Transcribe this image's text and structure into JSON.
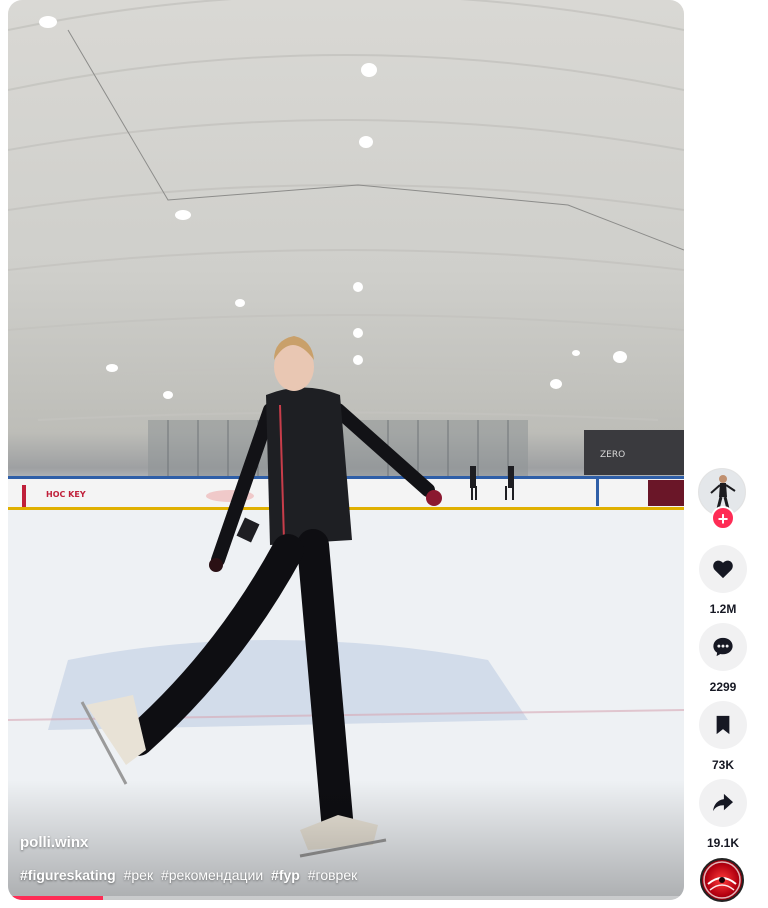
{
  "video": {
    "author": "polli.winx",
    "caption_tags": [
      {
        "text": "#figureskating",
        "bold": true
      },
      {
        "text": "#рек",
        "bold": false
      },
      {
        "text": "#рекомендации",
        "bold": false
      },
      {
        "text": "#fyp",
        "bold": true
      },
      {
        "text": "#говрек",
        "bold": false
      }
    ],
    "progress_fraction": 0.14,
    "background_signs": [
      "HOC KEY",
      "ZERO"
    ]
  },
  "actions": {
    "follow_label": "+",
    "like": {
      "icon": "heart-icon",
      "count": "1.2M"
    },
    "comment": {
      "icon": "comment-icon",
      "count": "2299"
    },
    "save": {
      "icon": "bookmark-icon",
      "count": "73K"
    },
    "share": {
      "icon": "share-icon",
      "count": "19.1K"
    },
    "music": {
      "icon": "music-disc-icon"
    }
  },
  "colors": {
    "accent": "#fe2c55",
    "icon": "#161823",
    "button_bg": "#f1f1f2"
  }
}
